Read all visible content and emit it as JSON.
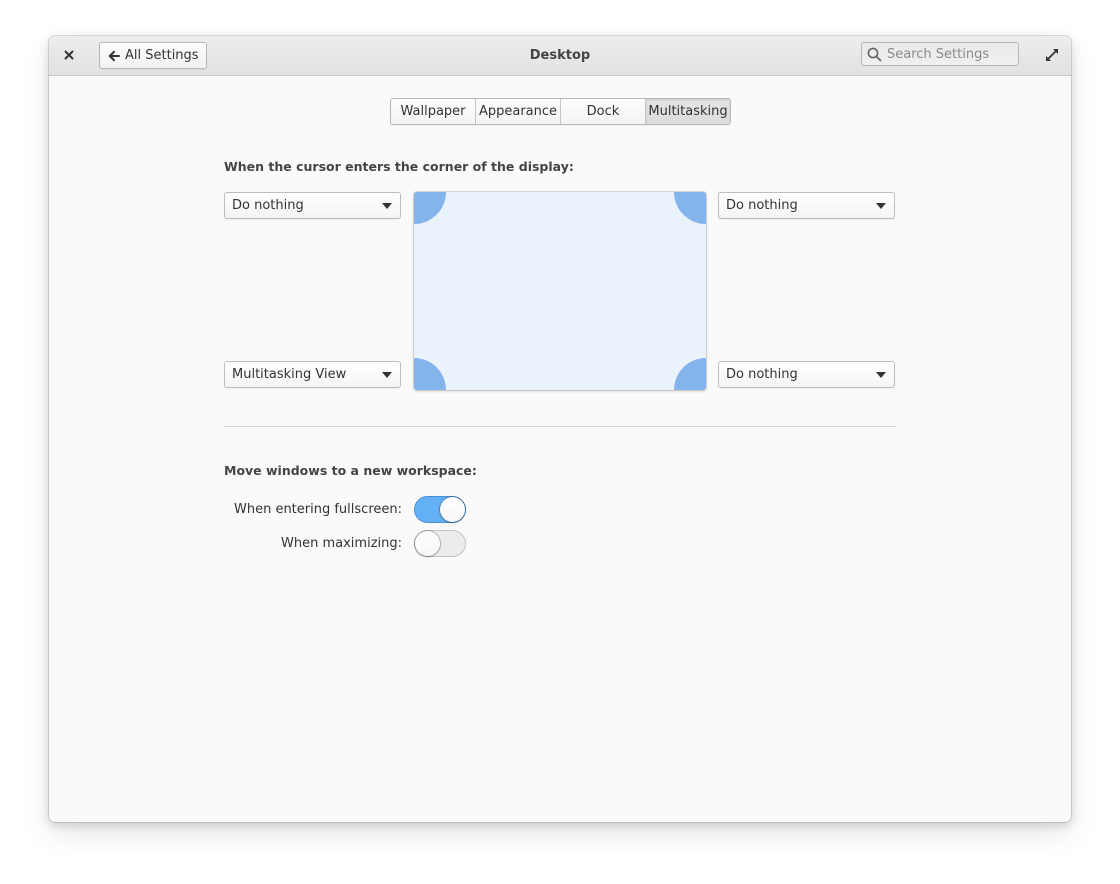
{
  "header": {
    "title": "Desktop",
    "back_label": "All Settings",
    "search_placeholder": "Search Settings",
    "close_icon": "close-icon",
    "maximize_icon": "maximize-icon"
  },
  "tabs": [
    {
      "label": "Wallpaper",
      "active": false
    },
    {
      "label": "Appearance",
      "active": false
    },
    {
      "label": "Dock",
      "active": false
    },
    {
      "label": "Multitasking",
      "active": true
    }
  ],
  "hot_corners": {
    "heading": "When the cursor enters the corner of the display:",
    "top_left": "Do nothing",
    "top_right": "Do nothing",
    "bottom_left": "Multitasking View",
    "bottom_right": "Do nothing",
    "corner_color": "#83b4ec",
    "preview_color": "#eaf3fc"
  },
  "workspaces": {
    "heading": "Move windows to a new workspace:",
    "fullscreen_label": "When entering fullscreen:",
    "fullscreen_on": true,
    "maximize_label": "When maximizing:",
    "maximize_on": false,
    "accent_color": "#64b0f6"
  }
}
